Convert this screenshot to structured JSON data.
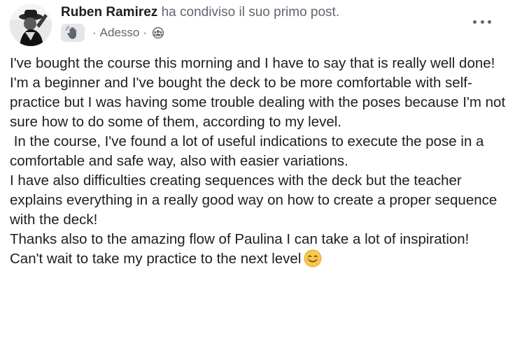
{
  "post": {
    "author": "Ruben Ramirez",
    "action_text": " ha condiviso il suo primo post.",
    "badge_icon": "waving-hand-icon",
    "time": "Adesso",
    "separator": "·",
    "privacy_icon": "group-privacy-icon",
    "more_icon": "more-options-icon",
    "paragraphs": [
      "I've bought the course this morning and I have to say that is really well done!",
      "I'm a beginner and I've bought the deck to be more comfortable with self-practice but I was having some trouble dealing with the poses because I'm not sure how to do some of them, according to my level.",
      " In the course, I've found a lot of useful indications to execute the pose in a comfortable and safe way, also with easier variations.",
      "I have also difficulties creating sequences with the deck but the teacher explains everything in a really good way on how to create a proper sequence with the deck!",
      "Thanks also to the amazing flow of Paulina I can take a lot of inspiration!",
      "Can't wait to take my practice to the next level"
    ],
    "closing_emoji": "smiling-face-emoji"
  },
  "colors": {
    "text": "#1c1e21",
    "secondary": "#606770",
    "badge_bg": "#e4e6eb",
    "emoji_face": "#f7c948"
  }
}
